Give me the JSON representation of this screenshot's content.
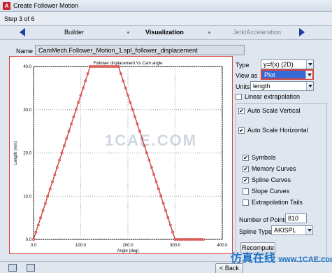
{
  "window": {
    "title": "Create Follower Motion"
  },
  "step": {
    "text": "Step 3 of 6"
  },
  "nav": {
    "tabs": [
      "Builder",
      "Visualization",
      "Jerk/Acceleration"
    ]
  },
  "name": {
    "label": "Name",
    "value": "CamMech.Follower_Motion_1.spl_follower_displacement"
  },
  "controls": {
    "type_label": "Type",
    "type_value": "y=f(x)   (2D)",
    "viewas_label": "View as",
    "viewas_value": "Plot",
    "units_label": "Units",
    "units_value": "length",
    "linear_extrap": "Linear extrapolation",
    "auto_vertical": "Auto Scale Vertical",
    "auto_horizontal": "Auto Scale Horizontal",
    "symbols": "Symbols",
    "memory_curves": "Memory Curves",
    "spline_curves": "Spline Curves",
    "slope_curves": "Slope Curves",
    "extrap_tails": "Extrapolation Tails",
    "points_label": "Number of Points",
    "points_value": "810",
    "spline_type_label": "Spline Type",
    "spline_type_value": "AKISPL",
    "recompute": "Recompute",
    "checked": {
      "linear_extrap": false,
      "auto_vertical": true,
      "auto_horizontal": true,
      "symbols": true,
      "memory_curves": true,
      "spline_curves": true,
      "slope_curves": false,
      "extrap_tails": false
    }
  },
  "bottom": {
    "back": "< Back"
  },
  "watermark": {
    "text": "仿真在线",
    "url": "www.1CAE.com",
    "center": "1CAE.COM"
  },
  "chart_data": {
    "type": "line",
    "title": "Follower displacement Vs Cam angle",
    "xlabel": "Angle (deg)",
    "ylabel": "Length (mm)",
    "xlim": [
      0,
      400
    ],
    "ylim": [
      0,
      40
    ],
    "xticks": [
      "0.0",
      "100.0",
      "200.0",
      "300.0",
      "400.0"
    ],
    "yticks": [
      "0.0",
      "10.0",
      "20.0",
      "30.0",
      "40.0"
    ],
    "grid": true,
    "series": [
      {
        "x": [
          0,
          120,
          180,
          300,
          360
        ],
        "y": [
          0,
          40,
          40,
          0,
          0
        ],
        "color": "#d5433d"
      }
    ]
  }
}
